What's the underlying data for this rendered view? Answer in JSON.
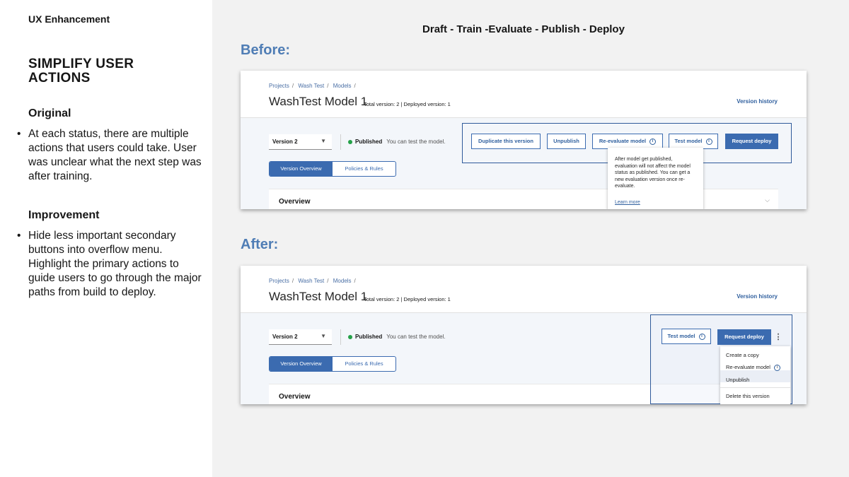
{
  "left": {
    "tag": "UX Enhancement",
    "headline": "SIMPLIFY USER ACTIONS",
    "original_title": "Original",
    "original_bullet": "At each status, there are multiple actions that users could take. User was unclear what the next step was after training.",
    "improvement_title": "Improvement",
    "improvement_bullet": "Hide less important secondary buttons into overflow menu. Highlight the primary actions to guide users to go through the major paths from build to deploy."
  },
  "flow": "Draft - Train -Evaluate - Publish - Deploy",
  "before_label": "Before:",
  "after_label": "After:",
  "common": {
    "breadcrumbs": [
      "Projects",
      "Wash Test",
      "Models"
    ],
    "breadcrumb_sep": "/",
    "model_title": "WashTest Model 1",
    "model_meta": "Total version: 2  |  Deployed version: 1",
    "version_history": "Version history",
    "version_select": "Version 2",
    "status": "Published",
    "status_note": "You can test the model.",
    "tab_overview": "Version Overview",
    "tab_policies": "Policies & Rules",
    "overview": "Overview",
    "colors": {
      "primary": "#3b6bb0",
      "accent_label": "#4f7db5",
      "status_green": "#24a148"
    }
  },
  "before": {
    "buttons": {
      "duplicate": "Duplicate this version",
      "unpublish": "Unpublish",
      "reevaluate": "Re-evaluate model",
      "test": "Test model",
      "request_deploy": "Request deploy"
    },
    "tooltip": {
      "text": "After model get published, evaluation will not affect the model status as published. You can get a new evaluation version once re-evaluate.",
      "link": "Learn more"
    }
  },
  "after": {
    "buttons": {
      "test": "Test model",
      "request_deploy": "Request deploy"
    },
    "menu": {
      "create_copy": "Create a copy",
      "reevaluate": "Re-evaluate model",
      "unpublish": "Unpublish",
      "delete": "Delete this version"
    }
  }
}
